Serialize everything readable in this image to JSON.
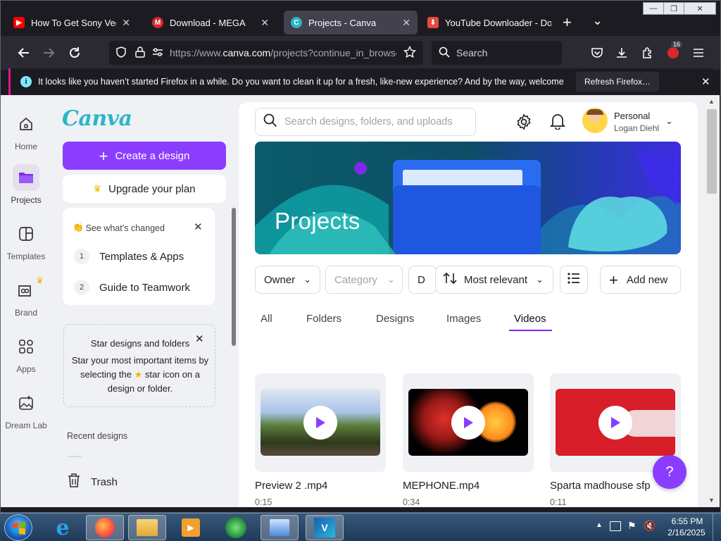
{
  "browser": {
    "tabs": [
      {
        "title": "How To Get Sony Vegas Pro",
        "favicon_color": "#ff0000",
        "favicon_glyph": "▶"
      },
      {
        "title": "Download - MEGA",
        "favicon_color": "#d9272e",
        "favicon_glyph": "M"
      },
      {
        "title": "Projects - Canva",
        "favicon_color": "#7d2ae8",
        "favicon_glyph": "C"
      },
      {
        "title": "YouTube Downloader - Do",
        "favicon_color": "#e8493a",
        "favicon_glyph": "⬇"
      }
    ],
    "new_tab": "+",
    "tab_list": "⌄",
    "url_prefix": "https://www.",
    "url_domain": "canva.com",
    "url_path": "/projects?continue_in_browser",
    "search_placeholder": "Search",
    "badge_count": "16",
    "window_controls": [
      "—",
      "❐",
      "✕"
    ]
  },
  "notification": {
    "text": "It looks like you haven’t started Firefox in a while. Do you want to clean it up for a fresh, like-new experience? And by the way, welcome back!",
    "button": "Refresh Firefox…"
  },
  "rail": {
    "items": [
      {
        "label": "Home",
        "icon": "home-icon"
      },
      {
        "label": "Projects",
        "icon": "folder-icon"
      },
      {
        "label": "Templates",
        "icon": "templates-icon"
      },
      {
        "label": "Brand",
        "icon": "brand-icon"
      },
      {
        "label": "Apps",
        "icon": "apps-icon"
      },
      {
        "label": "Dream Lab",
        "icon": "dream-lab-icon"
      }
    ]
  },
  "sidebar": {
    "logo": "Canva",
    "create_button": "Create a design",
    "upgrade_button": "Upgrade your plan",
    "whats_changed": {
      "title": "See what’s changed",
      "items": [
        {
          "num": "1",
          "label": "Templates & Apps"
        },
        {
          "num": "2",
          "label": "Guide to Teamwork"
        }
      ]
    },
    "star_tip": {
      "title": "Star designs and folders",
      "body_1": "Star your most important items by",
      "body_2a": "selecting the",
      "body_2b": "star icon on a",
      "body_3": "design or folder."
    },
    "recent_label": "Recent designs",
    "trash": "Trash"
  },
  "header": {
    "search_placeholder": "Search designs, folders, and uploads",
    "account_type": "Personal",
    "user_name": "Logan Diehl"
  },
  "banner": {
    "title": "Projects"
  },
  "filters": {
    "owner": "Owner",
    "category": "Category",
    "date_partial": "D",
    "sort": "Most relevant",
    "add_new": "Add new"
  },
  "tabs": {
    "items": [
      "All",
      "Folders",
      "Designs",
      "Images",
      "Videos"
    ],
    "active": "Videos"
  },
  "videos": [
    {
      "name": "Preview 2 .mp4",
      "duration": "0:15"
    },
    {
      "name": "MEPHONE.mp4",
      "duration": "0:34"
    },
    {
      "name": "Sparta madhouse sfp",
      "duration": "0:11"
    }
  ],
  "help_button": "?",
  "taskbar": {
    "time": "6:55 PM",
    "date": "2/16/2025"
  },
  "colors": {
    "canva_purple": "#7d2ae8",
    "firefox_dark": "#1c1b22",
    "active_tab_underline": "#7d2ae8"
  }
}
